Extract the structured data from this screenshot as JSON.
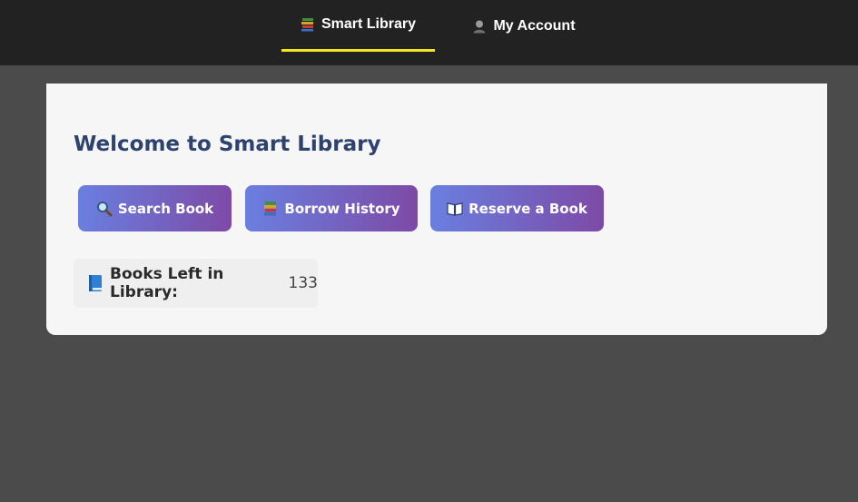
{
  "nav": {
    "items": [
      {
        "label": "Smart Library",
        "icon": "books-icon",
        "active": true
      },
      {
        "label": "My Account",
        "icon": "user-icon",
        "active": false
      }
    ],
    "active_color": "#f0e81c"
  },
  "main": {
    "title": "Welcome to Smart Library",
    "buttons": [
      {
        "label": "Search Book",
        "icon": "magnifier-icon"
      },
      {
        "label": "Borrow History",
        "icon": "books-icon"
      },
      {
        "label": "Reserve a Book",
        "icon": "open-book-icon"
      }
    ],
    "stat": {
      "label": "Books Left in Library:",
      "value": "133",
      "icon": "blue-book-icon"
    }
  },
  "colors": {
    "title": "#2e4270",
    "button_gradient_start": "#6a7fe0",
    "button_gradient_end": "#7d4aa6",
    "topbar": "#222222",
    "background": "#4b4b4b"
  }
}
